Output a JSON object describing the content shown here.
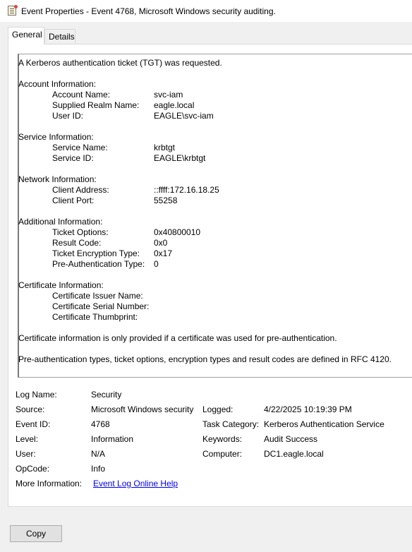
{
  "window": {
    "title": "Event Properties - Event 4768, Microsoft Windows security auditing.",
    "icon": "event-log-icon"
  },
  "tabs": [
    {
      "label": "General",
      "active": true
    },
    {
      "label": "Details",
      "active": false
    }
  ],
  "description": {
    "intro": "A Kerberos authentication ticket (TGT) was requested.",
    "account": {
      "heading": "Account Information:",
      "rows": [
        {
          "label": "Account Name:",
          "value": "svc-iam"
        },
        {
          "label": "Supplied Realm Name:",
          "value": "eagle.local"
        },
        {
          "label": "User ID:",
          "value": "EAGLE\\svc-iam"
        }
      ]
    },
    "service": {
      "heading": "Service Information:",
      "rows": [
        {
          "label": "Service Name:",
          "value": "krbtgt"
        },
        {
          "label": "Service ID:",
          "value": "EAGLE\\krbtgt"
        }
      ]
    },
    "network": {
      "heading": "Network Information:",
      "rows": [
        {
          "label": "Client Address:",
          "value": "::ffff:172.16.18.25"
        },
        {
          "label": "Client Port:",
          "value": "55258"
        }
      ]
    },
    "additional": {
      "heading": "Additional Information:",
      "rows": [
        {
          "label": "Ticket Options:",
          "value": "0x40800010"
        },
        {
          "label": "Result Code:",
          "value": "0x0"
        },
        {
          "label": "Ticket Encryption Type:",
          "value": "0x17"
        },
        {
          "label": "Pre-Authentication Type:",
          "value": "0"
        }
      ]
    },
    "certificate": {
      "heading": "Certificate Information:",
      "rows": [
        {
          "label": "Certificate Issuer Name:",
          "value": ""
        },
        {
          "label": "Certificate Serial Number:",
          "value": ""
        },
        {
          "label": "Certificate Thumbprint:",
          "value": ""
        }
      ]
    },
    "note1": "Certificate information is only provided if a certificate was used for pre-authentication.",
    "note2": "Pre-authentication types, ticket options, encryption types and result codes are defined in RFC 4120."
  },
  "meta": {
    "log_name": {
      "label": "Log Name:",
      "value": "Security"
    },
    "source": {
      "label": "Source:",
      "value": "Microsoft Windows security"
    },
    "logged": {
      "label": "Logged:",
      "value": "4/22/2025 10:19:39 PM"
    },
    "event_id": {
      "label": "Event ID:",
      "value": "4768"
    },
    "task_category": {
      "label": "Task Category:",
      "value": "Kerberos Authentication Service"
    },
    "level": {
      "label": "Level:",
      "value": "Information"
    },
    "keywords": {
      "label": "Keywords:",
      "value": "Audit Success"
    },
    "user": {
      "label": "User:",
      "value": "N/A"
    },
    "computer": {
      "label": "Computer:",
      "value": "DC1.eagle.local"
    },
    "opcode": {
      "label": "OpCode:",
      "value": "Info"
    },
    "more_info": {
      "label": "More Information:",
      "link": "Event Log Online Help"
    }
  },
  "buttons": {
    "copy": "Copy"
  }
}
